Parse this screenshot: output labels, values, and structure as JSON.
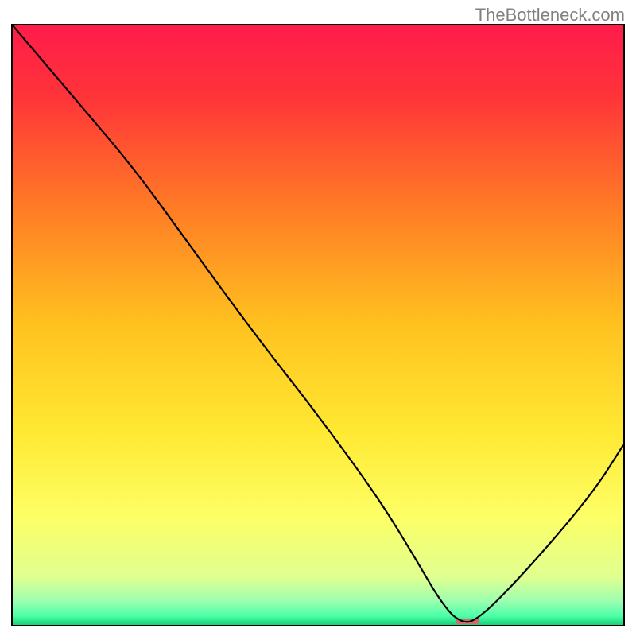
{
  "watermark": "TheBottleneck.com",
  "chart_data": {
    "type": "line",
    "title": "",
    "xlabel": "",
    "ylabel": "",
    "xlim": [
      0,
      100
    ],
    "ylim": [
      0,
      100
    ],
    "x": [
      0,
      10,
      20,
      28.5,
      40,
      50,
      60,
      66,
      70,
      73,
      76,
      85,
      95,
      100
    ],
    "y": [
      100,
      88,
      76,
      64,
      48,
      35,
      21,
      11,
      4,
      0.5,
      0.5,
      10,
      22,
      30
    ],
    "background_gradient": {
      "stops": [
        {
          "pos": 0.0,
          "color": "#ff1c4a"
        },
        {
          "pos": 0.12,
          "color": "#ff3439"
        },
        {
          "pos": 0.3,
          "color": "#ff7a26"
        },
        {
          "pos": 0.5,
          "color": "#ffc21f"
        },
        {
          "pos": 0.68,
          "color": "#ffe933"
        },
        {
          "pos": 0.82,
          "color": "#fdff66"
        },
        {
          "pos": 0.92,
          "color": "#e0ff90"
        },
        {
          "pos": 0.96,
          "color": "#9dffb0"
        },
        {
          "pos": 0.985,
          "color": "#4dffa8"
        },
        {
          "pos": 1.0,
          "color": "#18d27a"
        }
      ]
    },
    "marker": {
      "x": 74.5,
      "y": 0.6,
      "w": 4,
      "h": 0.9,
      "color": "#d46a6a"
    }
  }
}
